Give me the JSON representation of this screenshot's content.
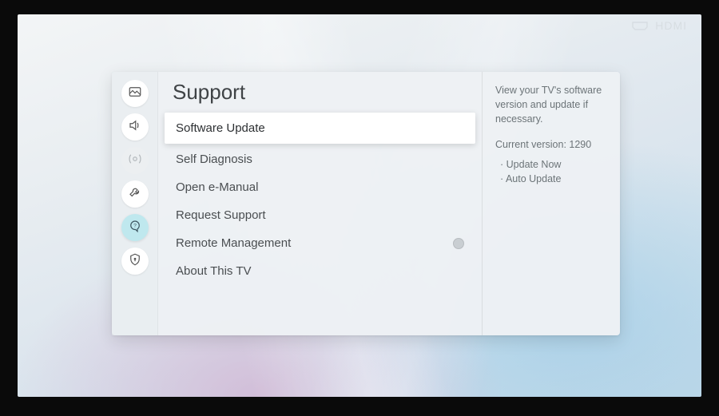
{
  "input_badge": {
    "label": "HDMI"
  },
  "nav": {
    "items": [
      {
        "name": "picture-icon"
      },
      {
        "name": "sound-icon"
      },
      {
        "name": "broadcast-icon"
      },
      {
        "name": "general-icon"
      },
      {
        "name": "support-icon"
      },
      {
        "name": "privacy-icon"
      }
    ]
  },
  "center": {
    "title": "Support",
    "items": [
      {
        "label": "Software Update",
        "selected": true
      },
      {
        "label": "Self Diagnosis"
      },
      {
        "label": "Open e-Manual"
      },
      {
        "label": "Request Support"
      },
      {
        "label": "Remote Management",
        "toggle": true
      },
      {
        "label": "About This TV"
      }
    ]
  },
  "side": {
    "description": "View your TV's software version and update if necessary.",
    "version_label": "Current version: 1290",
    "options": [
      "Update Now",
      "Auto Update"
    ]
  }
}
